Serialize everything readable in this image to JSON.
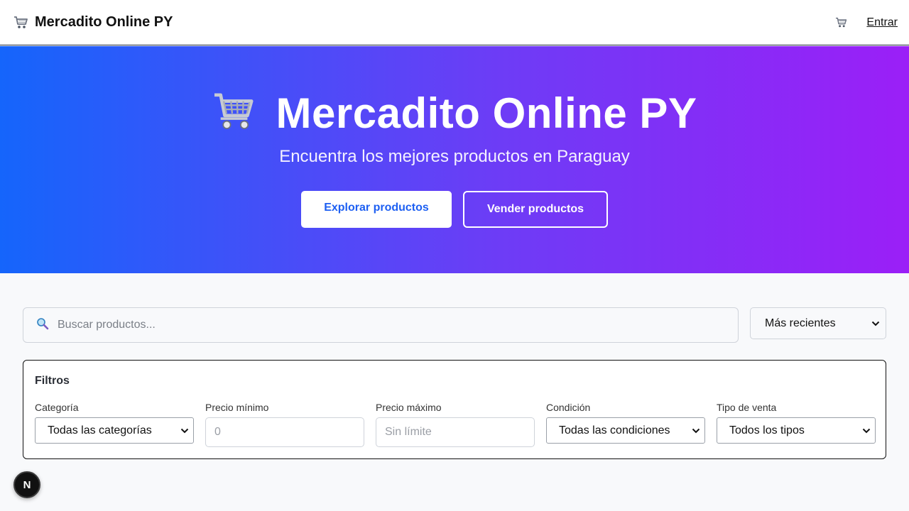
{
  "header": {
    "brand_title": "Mercadito Online PY",
    "brand_icon": "cart-icon",
    "cart_icon": "cart-icon",
    "login_label": "Entrar"
  },
  "hero": {
    "title": "Mercadito Online PY",
    "title_icon": "cart-icon",
    "subtitle": "Encuentra los mejores productos en Paraguay",
    "explore_label": "Explorar productos",
    "sell_label": "Vender productos",
    "gradient_start": "#1565fb",
    "gradient_end": "#9b1ff7"
  },
  "search": {
    "icon": "search-icon",
    "placeholder": "Buscar productos...",
    "value": ""
  },
  "sort": {
    "selected": "Más recientes"
  },
  "filters": {
    "title": "Filtros",
    "category": {
      "label": "Categoría",
      "selected": "Todas las categorías"
    },
    "min_price": {
      "label": "Precio mínimo",
      "placeholder": "0",
      "value": ""
    },
    "max_price": {
      "label": "Precio máximo",
      "placeholder": "Sin límite",
      "value": ""
    },
    "condition": {
      "label": "Condición",
      "selected": "Todas las condiciones"
    },
    "sale_type": {
      "label": "Tipo de venta",
      "selected": "Todos los tipos"
    }
  },
  "dev_badge": {
    "label": "N"
  }
}
